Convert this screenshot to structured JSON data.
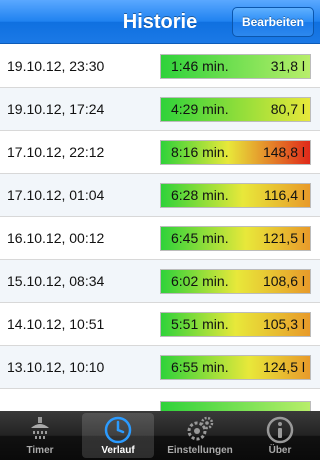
{
  "header": {
    "title": "Historie",
    "edit_label": "Bearbeiten"
  },
  "entries": [
    {
      "date": "19.10.12, 23:30",
      "duration": "1:46 min.",
      "volume": "31,8 l",
      "level": 0.21
    },
    {
      "date": "19.10.12, 17:24",
      "duration": "4:29 min.",
      "volume": "80,7 l",
      "level": 0.54
    },
    {
      "date": "17.10.12, 22:12",
      "duration": "8:16 min.",
      "volume": "148,8 l",
      "level": 1.0
    },
    {
      "date": "17.10.12, 01:04",
      "duration": "6:28 min.",
      "volume": "116,4 l",
      "level": 0.78
    },
    {
      "date": "16.10.12, 00:12",
      "duration": "6:45 min.",
      "volume": "121,5 l",
      "level": 0.82
    },
    {
      "date": "15.10.12, 08:34",
      "duration": "6:02 min.",
      "volume": "108,6 l",
      "level": 0.73
    },
    {
      "date": "14.10.12, 10:51",
      "duration": "5:51 min.",
      "volume": "105,3 l",
      "level": 0.71
    },
    {
      "date": "13.10.12, 10:10",
      "duration": "6:55 min.",
      "volume": "124,5 l",
      "level": 0.84
    },
    {
      "date": "",
      "duration": "",
      "volume": "",
      "level": 0.0
    }
  ],
  "tabs": [
    {
      "label": "Timer",
      "icon": "shower-icon"
    },
    {
      "label": "Verlauf",
      "icon": "clock-icon"
    },
    {
      "label": "Einstellungen",
      "icon": "gears-icon"
    },
    {
      "label": "Über",
      "icon": "info-icon"
    }
  ],
  "colors": {
    "navbar": "#1f82f0",
    "bar_low": "#2fd23a",
    "bar_mid": "#e8e83a",
    "bar_high": "#e0281a"
  }
}
